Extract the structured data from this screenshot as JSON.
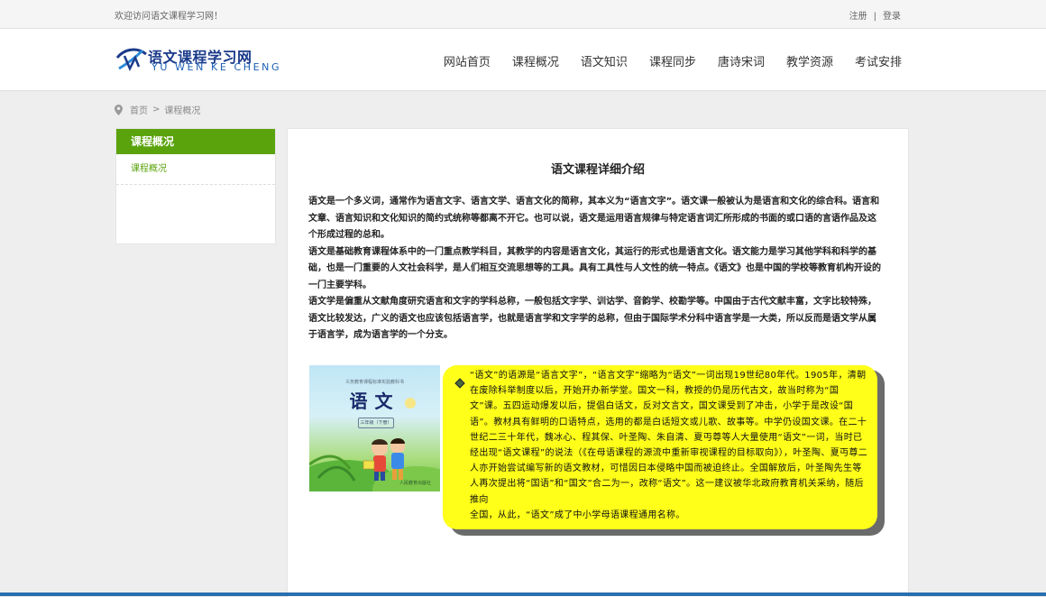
{
  "topbar": {
    "welcome": "欢迎访问语文课程学习网！",
    "register": "注册",
    "separator": "|",
    "login": "登录"
  },
  "logo": {
    "title_cn": "语文课程学习网",
    "title_en": "YU WEN KE CHENG"
  },
  "nav": {
    "items": [
      "网站首页",
      "课程概况",
      "语文知识",
      "课程同步",
      "唐诗宋词",
      "教学资源",
      "考试安排"
    ]
  },
  "breadcrumb": {
    "home": "首页",
    "separator": ">",
    "current": "课程概况"
  },
  "sidebar": {
    "title": "课程概况",
    "links": [
      "课程概况"
    ]
  },
  "article": {
    "title": "语文课程详细介绍",
    "paragraphs": [
      "语文是一个多义词，通常作为语言文字、语言文学、语言文化的简称，其本义为“语言文字”。语文课一般被认为是语言和文化的综合科。语言和文章、语言知识和文化知识的简约式统称等都离不开它。也可以说，语文是运用语言规律与特定语言词汇所形成的书面的或口语的言语作品及这个形成过程的总和。",
      "语文是基础教育课程体系中的一门重点教学科目，其教学的内容是语言文化，其运行的形式也是语言文化。语文能力是学习其他学科和科学的基础，也是一门重要的人文社会科学，是人们相互交流思想等的工具。具有工具性与人文性的统一特点。《语文》也是中国的学校等教育机构开设的一门主要学科。",
      "语文学是偏重从文献角度研究语言和文字的学科总称，一般包括文字学、训诂学、音韵学、校勘学等。中国由于古代文献丰富，文字比较特殊，语文比较发达，广义的语文也应该包括语言学，也就是语言学和文字学的总称，但由于国际学术分科中语言学是一大类，所以反而是语文学从属于语言学，成为语言学的一个分支。"
    ]
  },
  "book": {
    "publisher": "义务教育课程标准实验教科书",
    "title": "语文",
    "grade": "三年级（下册）",
    "footer": "人民教育出版社"
  },
  "note": {
    "lines": [
      "“语文”的语源是“语言文字”，“语言文字”缩略为“语文”一词出现19世纪80年代。1905年，清朝在废除科举制度以后，开始开办新学堂。国文一科，教授的仍是历代古文，故当时称为“国文”课。五四运动爆发以后，提倡白话文，反对文言文，国文课受到了冲击，小学于是改设“国语”。教材具有鲜明的口语特点，选用的都是白话短文或儿歌、故事等。中学仍设国文课。在二十世纪二三十年代，魏冰心、程其保、叶圣陶、朱自清、夏丏尊等人大量使用“语文”一词，当时已经出现“语文课程”的说法（《在母语课程的源流中重新审视课程的目标取向》），叶圣陶、夏丏尊二人亦开始尝试编写新的语文教材，可惜因日本侵略中国而被迫终止。全国解放后，叶圣陶先生等人再次提出将“国语”和“国文”合二为一，改称“语文”。这一建议被华北政府教育机关采纳，随后推向",
      "全国，从此，“语文”成了中小学母语课程通用名称。"
    ]
  },
  "colors": {
    "accent_green": "#5aa30c",
    "note_yellow": "#ffff1a",
    "logo_blue": "#1a3a8a"
  }
}
